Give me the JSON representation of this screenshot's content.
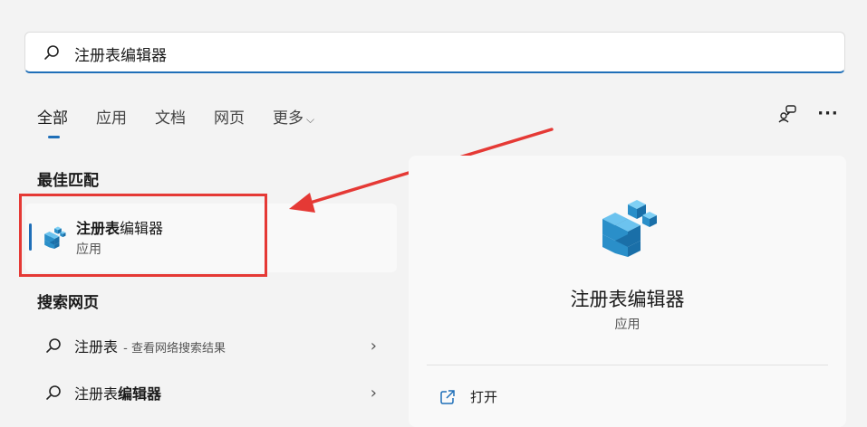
{
  "search": {
    "value": "注册表编辑器",
    "placeholder": ""
  },
  "tabs": [
    {
      "label": "全部",
      "active": true
    },
    {
      "label": "应用"
    },
    {
      "label": "文档"
    },
    {
      "label": "网页"
    },
    {
      "label": "更多"
    }
  ],
  "icons": {
    "search": "search-icon",
    "chevron": "chevron-down-icon",
    "share": "feedback-icon",
    "more": "more-icon",
    "open": "open-external-icon",
    "regedit": "registry-editor-icon"
  },
  "best_match": {
    "section_title": "最佳匹配",
    "name_bold": "注册表",
    "name_rest": "编辑器",
    "type": "应用"
  },
  "web_search": {
    "section_title": "搜索网页",
    "items": [
      {
        "prefix": "注册表",
        "bold": "",
        "suffix": " - 查看网络搜索结果"
      },
      {
        "prefix": "注册表",
        "bold": "编辑器",
        "suffix": ""
      }
    ]
  },
  "detail": {
    "title": "注册表编辑器",
    "type": "应用",
    "actions": [
      {
        "label": "打开"
      }
    ]
  },
  "colors": {
    "accent": "#1f6fb8",
    "highlight": "#e53935"
  }
}
